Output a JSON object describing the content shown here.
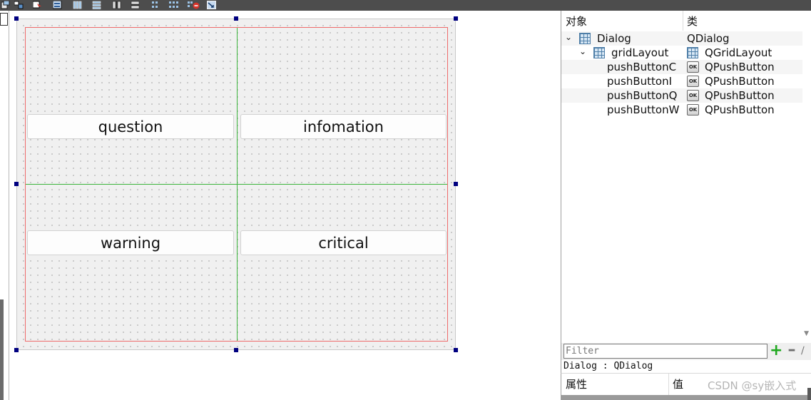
{
  "toolbar": {
    "icons": [
      "new-form-icon",
      "widget-box-icon",
      "edit-tab-order-icon",
      "edit-buddies-icon",
      "layout-horizontal-icon",
      "layout-vertical-icon",
      "layout-horizontal-splitter-icon",
      "layout-vertical-splitter-icon",
      "layout-form-icon",
      "layout-grid-icon",
      "break-layout-icon",
      "adjust-size-icon"
    ]
  },
  "form": {
    "buttons": {
      "question": "question",
      "infomation": "infomation",
      "warning": "warning",
      "critical": "critical"
    }
  },
  "object_inspector": {
    "header": {
      "object": "对象",
      "class": "类"
    },
    "rows": [
      {
        "name": "Dialog",
        "class": "QDialog"
      },
      {
        "name": "gridLayout",
        "class": "QGridLayout"
      },
      {
        "name": "pushButtonC",
        "class": "QPushButton"
      },
      {
        "name": "pushButtonI",
        "class": "QPushButton"
      },
      {
        "name": "pushButtonQ",
        "class": "QPushButton"
      },
      {
        "name": "pushButtonW",
        "class": "QPushButton"
      }
    ],
    "ok_icon_text": "OK"
  },
  "property_editor": {
    "filter_placeholder": "Filter",
    "selection": "Dialog : QDialog",
    "header": {
      "property": "属性",
      "value": "值"
    }
  },
  "watermark": "CSDN @sy嵌入式",
  "colors": {
    "toolbar_bg": "#4d4d4d",
    "canvas_bg": "#f0f0f0",
    "layout_frame": "#ef6b6b",
    "grid_lines": "#3cb43c",
    "selection_handle": "#000080",
    "add_green": "#1fa81f"
  }
}
